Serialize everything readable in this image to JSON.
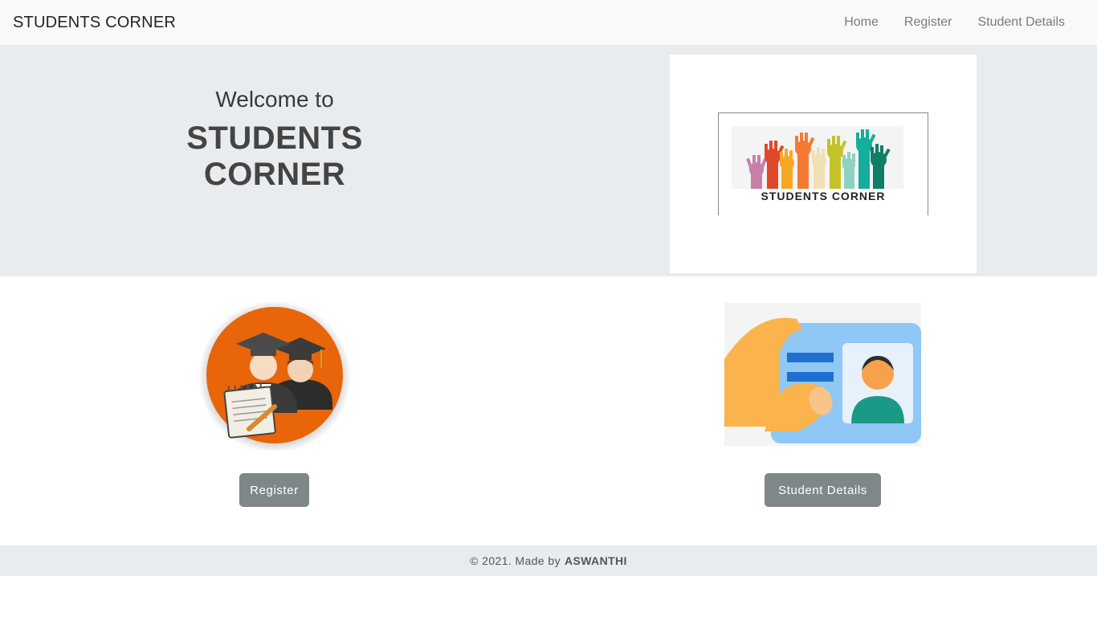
{
  "navbar": {
    "brand": "STUDENTS CORNER",
    "links": [
      "Home",
      "Register",
      "Student Details"
    ]
  },
  "hero": {
    "welcome": "Welcome to",
    "title": "STUDENTS CORNER",
    "logo_text": "STUDENTS CORNER"
  },
  "cards": {
    "register_button": "Register",
    "details_button": "Student Details"
  },
  "footer": {
    "prefix": "© 2021. Made by",
    "author": "ASWANTHI"
  },
  "colors": {
    "navbar_bg": "#f8f9fa",
    "hero_bg": "#e9ecef",
    "button_bg": "#7f8788",
    "register_icon_circle": "#e8650a",
    "id_card_blue": "#90c8f5",
    "hand_orange": "#fbb34b"
  },
  "icons": [
    "graduates-register-icon",
    "id-card-icon",
    "raised-hands-logo"
  ]
}
